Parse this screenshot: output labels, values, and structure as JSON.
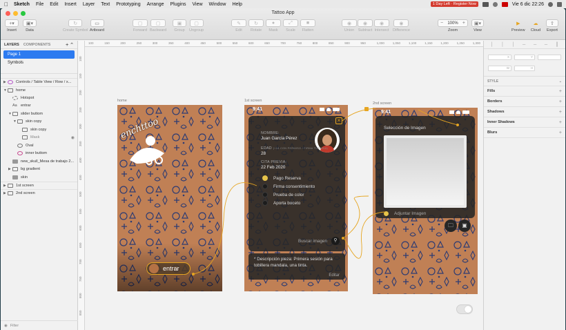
{
  "menubar": {
    "app": "Sketch",
    "items": [
      "File",
      "Edit",
      "Insert",
      "Layer",
      "Text",
      "Prototyping",
      "Arrange",
      "Plugins",
      "View",
      "Window",
      "Help"
    ],
    "badge": "1 Day Left · Register Now",
    "clock": "Vie 6 dic  22:26"
  },
  "window": {
    "title": "Tattoo App"
  },
  "toolbar": {
    "insert": "Insert",
    "data": "Data",
    "create_symbol": "Create Symbol",
    "artboard": "Artboard",
    "forward": "Forward",
    "backward": "Backward",
    "group": "Group",
    "ungroup": "Ungroup",
    "edit": "Edit",
    "rotate": "Rotate",
    "mask": "Mask",
    "scale": "Scale",
    "flatten": "Flatten",
    "union": "Union",
    "subtract": "Subtract",
    "intersect": "Intersect",
    "difference": "Difference",
    "zoom_label": "Zoom",
    "zoom_value": "100%",
    "view": "View",
    "preview": "Preview",
    "cloud": "Cloud",
    "export": "Export"
  },
  "left_panel": {
    "tab_layers": "LAYERS",
    "tab_components": "COMPONENTS",
    "pages": [
      "Page 1",
      "Symbols"
    ],
    "layers": [
      {
        "label": "Controls / Table View / Row / x...",
        "indent": 0,
        "icon": "sym",
        "arrow": "▶"
      },
      {
        "label": "home",
        "indent": 0,
        "icon": "artboard",
        "arrow": "▼"
      },
      {
        "label": "Hotspot",
        "indent": 1,
        "icon": "hotspot",
        "arrow": ""
      },
      {
        "label": "entrar",
        "indent": 1,
        "icon": "txt",
        "arrow": ""
      },
      {
        "label": "slider buttom",
        "indent": 1,
        "icon": "group",
        "arrow": "▼"
      },
      {
        "label": "skin copy",
        "indent": 2,
        "icon": "group",
        "arrow": "▼"
      },
      {
        "label": "skin copy",
        "indent": 3,
        "icon": "group",
        "arrow": ""
      },
      {
        "label": "Mask",
        "indent": 3,
        "icon": "shape",
        "arrow": "",
        "muted": true
      },
      {
        "label": "Oval",
        "indent": 2,
        "icon": "oval",
        "arrow": ""
      },
      {
        "label": "inner buttom",
        "indent": 2,
        "icon": "pink",
        "arrow": ""
      },
      {
        "label": "new_skull_Mesa de trabajo 2...",
        "indent": 1,
        "icon": "img",
        "arrow": ""
      },
      {
        "label": "bg gradient",
        "indent": 1,
        "icon": "group",
        "arrow": "▶"
      },
      {
        "label": "skin",
        "indent": 1,
        "icon": "img",
        "arrow": ""
      },
      {
        "label": "1st screen",
        "indent": 0,
        "icon": "artboard",
        "arrow": "▶"
      },
      {
        "label": "2nd screen",
        "indent": 0,
        "icon": "artboard",
        "arrow": "▶"
      }
    ],
    "filter_placeholder": "Filter"
  },
  "right_panel": {
    "style": "STYLE",
    "sections": [
      "Fills",
      "Borders",
      "Shadows",
      "Inner Shadows",
      "Blurs"
    ],
    "field_x": "X",
    "field_y": "Y",
    "field_w": "W",
    "field_h": "H"
  },
  "ruler": {
    "h": [
      "100",
      "150",
      "200",
      "250",
      "300",
      "350",
      "400",
      "450",
      "500",
      "550",
      "600",
      "650",
      "700",
      "750",
      "800",
      "850",
      "900",
      "950",
      "1,000",
      "1,050",
      "1,100",
      "1,150",
      "1,200",
      "1,250",
      "1,300",
      "1,350",
      "1,400"
    ],
    "v": [
      "100",
      "150",
      "200",
      "250",
      "300",
      "350",
      "400",
      "450",
      "500",
      "550",
      "600",
      "650",
      "700",
      "750",
      "800",
      "850"
    ]
  },
  "artboards": {
    "home": {
      "label": "home",
      "logo_text": "enchttoo",
      "button_label": "entrar"
    },
    "first": {
      "label": "1st screen",
      "time": "9:41",
      "name_label": "NOMBRE:",
      "name_value": "Juan García Pérez",
      "age_label": "EDAD",
      "age_note": "(+18 CON PERMISO / FIRMA TUTORIA)",
      "age_value": "28",
      "date_label": "CITA PREVIA:",
      "date_value": "22 Feb 2020",
      "steps": [
        "Pago Reserva",
        "Firma consentimiento",
        "Prueba de color",
        "Aporta boceto"
      ],
      "search_label": "Buscar imagen",
      "description": "* Descripción pieza: Primera sesión para tobillera mandala, una tinta.",
      "edit_label": "Editar"
    },
    "second": {
      "label": "2nd screen",
      "time": "9:41",
      "title": "Selección de Imagen",
      "attach_label": "Adjuntar Imagen"
    }
  },
  "colors": {
    "accent": "#2d7bf0",
    "prototype_link": "#e6a521",
    "card_bg": "#262626",
    "skin": "#c08055"
  }
}
